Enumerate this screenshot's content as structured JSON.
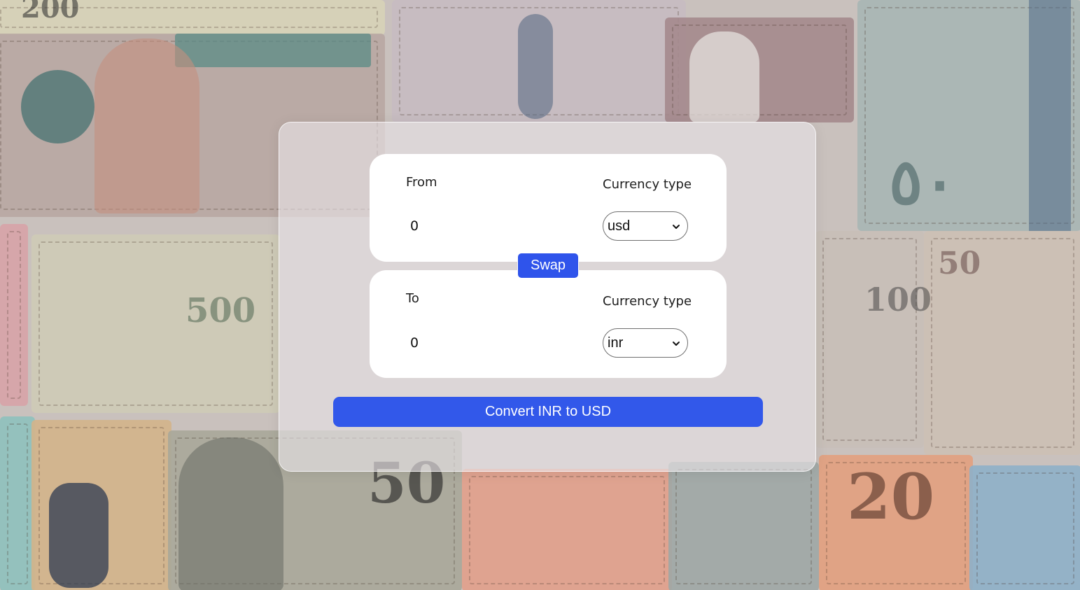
{
  "from": {
    "label": "From",
    "currency_label": "Currency type",
    "amount": "0",
    "currency": "usd"
  },
  "to": {
    "label": "To",
    "currency_label": "Currency type",
    "amount": "0",
    "currency": "inr"
  },
  "swap_label": "Swap",
  "convert_label": "Convert INR to USD",
  "colors": {
    "primary": "#3258ea",
    "card": "#ffffff",
    "panel": "#e8e4e6"
  },
  "icons": {
    "dropdown": "chevron-down-icon"
  }
}
